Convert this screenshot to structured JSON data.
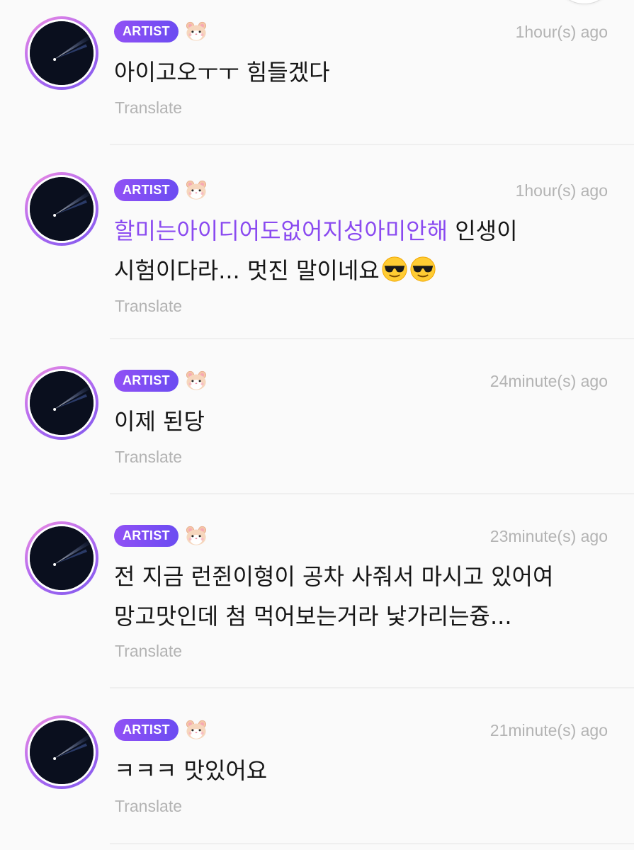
{
  "comments": [
    {
      "badge": "ARTIST",
      "sticker": "hamster-icon",
      "time": "1hour(s) ago",
      "text": "아이고오ㅜㅜ 힘들겠다",
      "translate": "Translate"
    },
    {
      "badge": "ARTIST",
      "sticker": "hamster-icon",
      "time": "1hour(s) ago",
      "mention": "할미는아이디어도없어지성아미안해",
      "text": " 인생이 시험이다라... 멋진 말이네요",
      "emojis": [
        "sunglasses-emoji",
        "sunglasses-emoji"
      ],
      "translate": "Translate"
    },
    {
      "badge": "ARTIST",
      "sticker": "hamster-icon",
      "time": "24minute(s) ago",
      "text": "이제 된당",
      "translate": "Translate"
    },
    {
      "badge": "ARTIST",
      "sticker": "hamster-icon",
      "time": "23minute(s) ago",
      "text": "전 지금 런쥔이형이 공차 사줘서 마시고 있어여 망고맛인데 첨 먹어보는거라 낯가리는즁...",
      "translate": "Translate"
    },
    {
      "badge": "ARTIST",
      "sticker": "hamster-icon",
      "time": "21minute(s) ago",
      "text": "ㅋㅋㅋ 맛있어요",
      "translate": "Translate"
    }
  ],
  "colors": {
    "badge": "#7a4ef3",
    "mention": "#8a4af0",
    "muted": "#b3b3b3",
    "avatar_ring": "#b46cf0"
  }
}
